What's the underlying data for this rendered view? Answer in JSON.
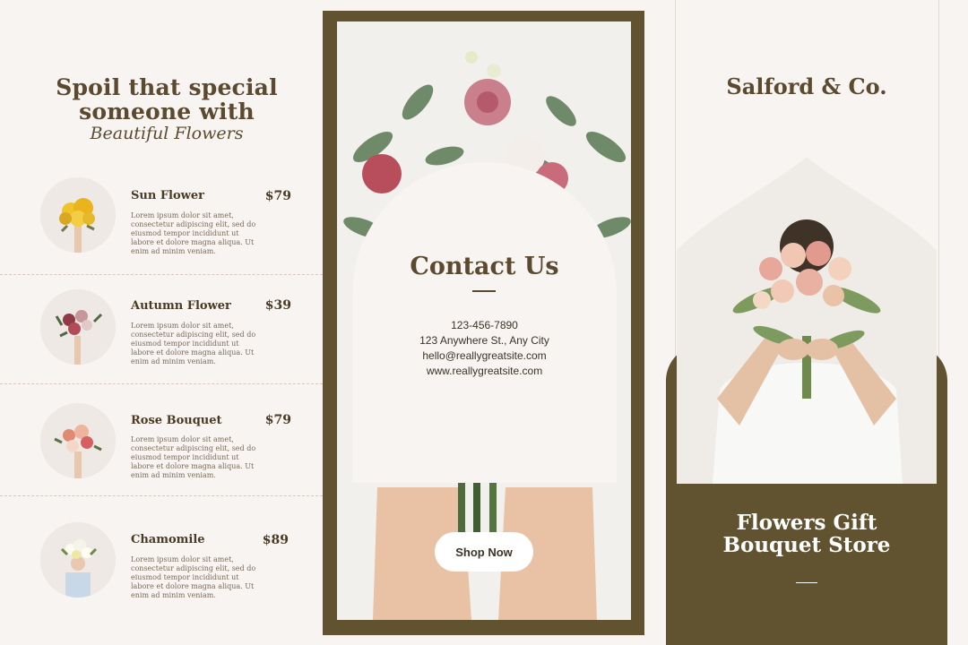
{
  "left": {
    "headline_line1": "Spoil that special",
    "headline_line2": "someone with",
    "headline_script": "Beautiful Flowers",
    "items": [
      {
        "name": "Sun Flower",
        "price": "$79",
        "desc": "Lorem ipsum dolor sit amet, consectetur adipiscing elit, sed do eiusmod tempor incididunt ut labore et dolore magna aliqua. Ut enim ad minim veniam."
      },
      {
        "name": "Autumn Flower",
        "price": "$39",
        "desc": "Lorem ipsum dolor sit amet, consectetur adipiscing elit, sed do eiusmod tempor incididunt ut labore et dolore magna aliqua. Ut enim ad minim veniam."
      },
      {
        "name": "Rose Bouquet",
        "price": "$79",
        "desc": "Lorem ipsum dolor sit amet, consectetur adipiscing elit, sed do eiusmod tempor incididunt ut labore et dolore magna aliqua. Ut enim ad minim veniam."
      },
      {
        "name": "Chamomile",
        "price": "$89",
        "desc": "Lorem ipsum dolor sit amet, consectetur adipiscing elit, sed do eiusmod tempor incididunt ut labore et dolore magna aliqua. Ut enim ad minim veniam."
      }
    ]
  },
  "middle": {
    "contact_title": "Contact Us",
    "phone": "123-456-7890",
    "address": "123 Anywhere St., Any City",
    "email": "hello@reallygreatsite.com",
    "website": "www.reallygreatsite.com",
    "cta_label": "Shop Now"
  },
  "right": {
    "brand": "Salford & Co.",
    "headline_line1": "Flowers Gift",
    "headline_line2": "Bouquet Store"
  },
  "colors": {
    "olive": "#61532f",
    "brown_text": "#5b4a2f",
    "cream": "#f7f4f1",
    "white": "#ffffff"
  }
}
